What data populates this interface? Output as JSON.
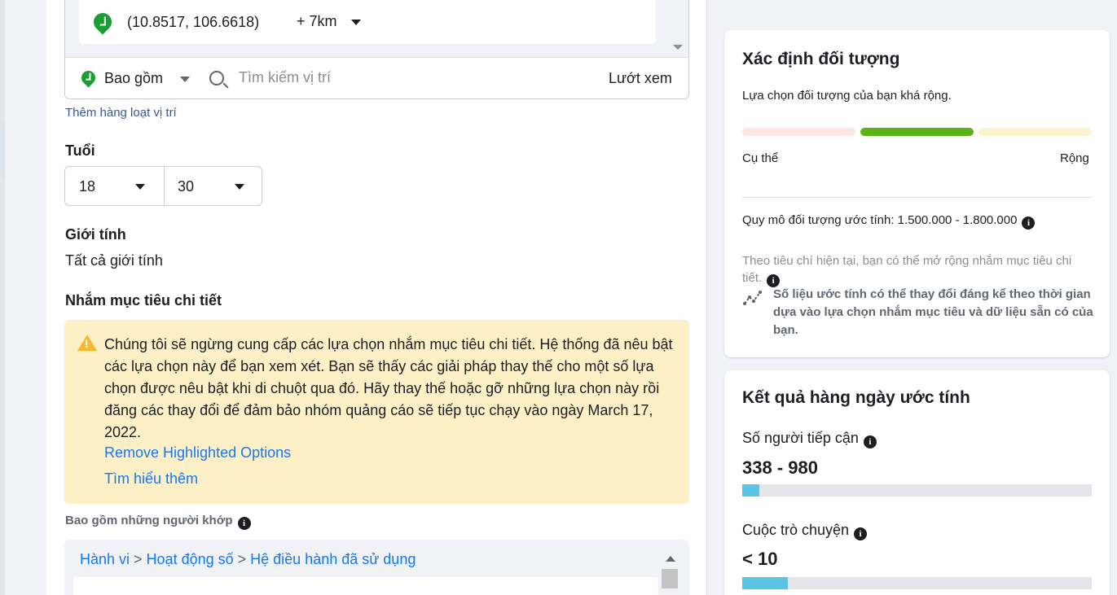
{
  "location": {
    "coordinates": "(10.8517, 106.6618)",
    "radius": "+ 7km",
    "include_label": "Bao gồm",
    "search_placeholder": "Tìm kiếm vị trí",
    "browse_label": "Lướt xem",
    "bulk_link": "Thêm hàng loạt vị trí"
  },
  "age": {
    "label": "Tuổi",
    "min": "18",
    "max": "30"
  },
  "gender": {
    "label": "Giới tính",
    "value": "Tất cả giới tính"
  },
  "detailed_targeting": {
    "label": "Nhắm mục tiêu chi tiết",
    "warning_text": "Chúng tôi sẽ ngừng cung cấp các lựa chọn nhắm mục tiêu chi tiết. Hệ thống đã nêu bật các lựa chọn này để bạn xem xét. Bạn sẽ thấy các giải pháp thay thế cho một số lựa chọn được nêu bật khi di chuột qua đó. Hãy thay thế hoặc gỡ những lựa chọn này rồi đăng các thay đổi để đảm bảo nhóm quảng cáo sẽ tiếp tục chạy vào ngày March 17, 2022.",
    "remove_link": "Remove Highlighted Options",
    "learn_more_link": "Tìm hiểu thêm",
    "match_label": "Bao gồm những người khớp",
    "breadcrumb": [
      "Hành vi",
      "Hoạt động số",
      "Hệ điều hành đã sử dụng"
    ],
    "breadcrumb_sep": " > "
  },
  "audience_definition": {
    "title": "Xác định đối tượng",
    "description": "Lựa chọn đối tượng của bạn khá rộng.",
    "meter_low": "Cụ thể",
    "meter_high": "Rộng",
    "meter_colors": [
      "#fde5e2",
      "#5bb318",
      "#fdf3cf"
    ],
    "size_line": "Quy mô đối tượng ước tính: 1.500.000 - 1.800.000",
    "hint": "Theo tiêu chí hiện tại, bạn có thể mở rộng nhắm mục tiêu chi tiết.",
    "trend_note": "Số liệu ước tính có thể thay đổi đáng kể theo thời gian dựa vào lựa chọn nhắm mục tiêu và dữ liệu sẵn có của bạn."
  },
  "daily_results": {
    "title": "Kết quả hàng ngày ước tính",
    "reach_label": "Số người tiếp cận",
    "reach_value": "338 - 980",
    "reach_fill_fraction": 0.05,
    "conversations_label": "Cuộc trò chuyện",
    "conversations_value": "< 10",
    "conversations_fill_fraction": 0.13,
    "bar_color": "#5bc5e8"
  }
}
